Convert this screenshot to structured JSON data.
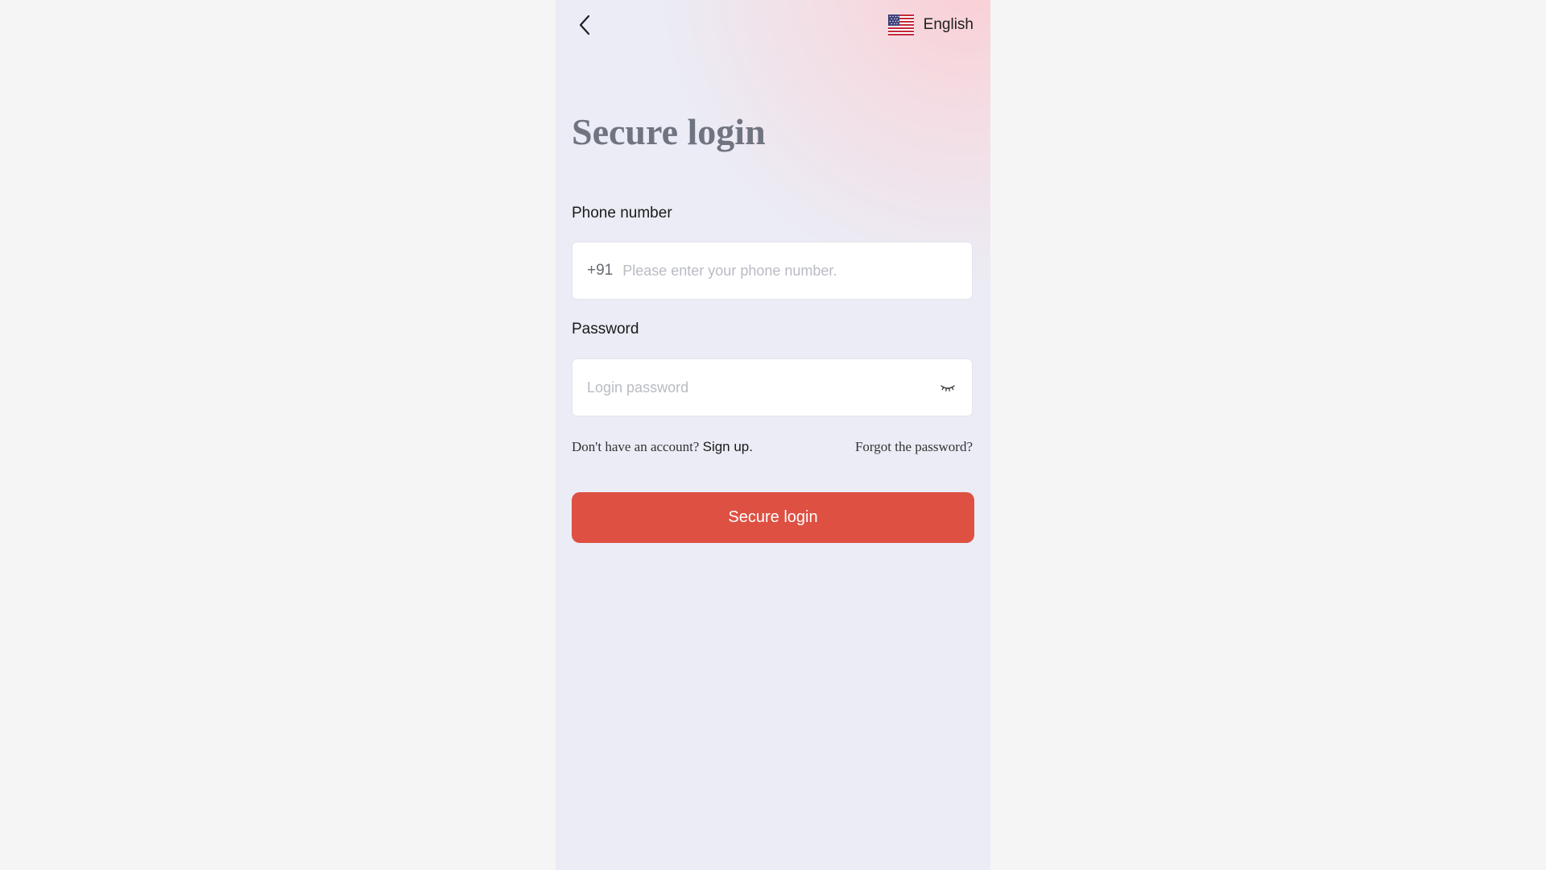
{
  "colors": {
    "page_background": "#f5f5f5",
    "card_background": "#ebecf5",
    "accent_pink": "#facdd2",
    "primary_button": "#de5042",
    "title_text": "#707480"
  },
  "header": {
    "back_icon": "chevron-left-icon",
    "language": {
      "flag_icon": "us-flag-icon",
      "label": "English"
    }
  },
  "title": "Secure login",
  "phone_field": {
    "label": "Phone number",
    "country_code": "+91",
    "value": "",
    "placeholder": "Please enter your phone number."
  },
  "password_field": {
    "label": "Password",
    "value": "",
    "placeholder": "Login password",
    "toggle_icon": "eye-closed-icon"
  },
  "links": {
    "no_account_text": "Don't have an account?",
    "signup_label": "Sign up.",
    "forgot_label": "Forgot the password?"
  },
  "submit_label": "Secure login"
}
